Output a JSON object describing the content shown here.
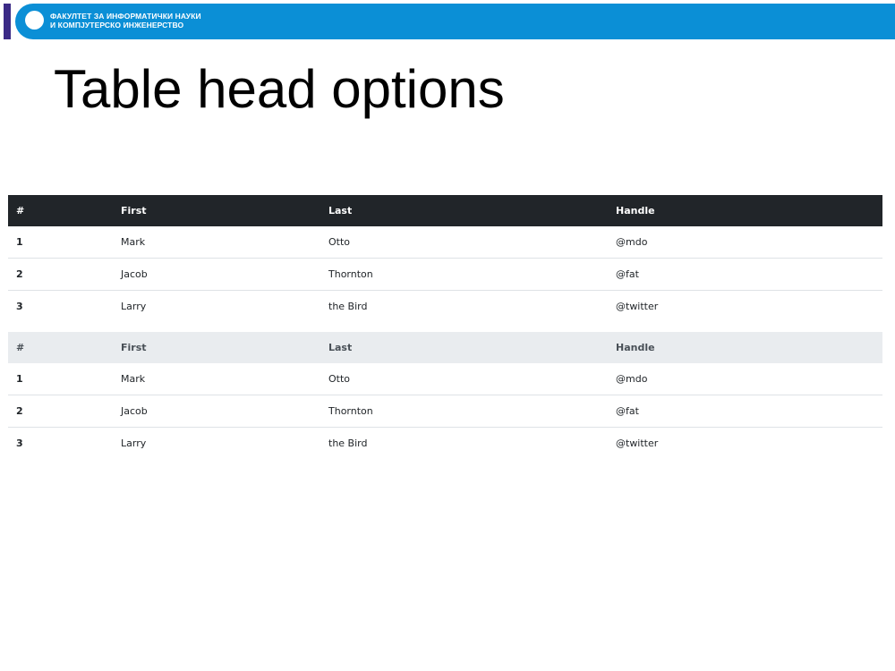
{
  "banner": {
    "line1": "ФАКУЛТЕТ ЗА ИНФОРМАТИЧКИ НАУКИ",
    "line2": "И КОМПЈУТЕРСКО ИНЖЕНЕРСТВО"
  },
  "title": "Table head options",
  "colors": {
    "banner": "#0b8fd6",
    "stripe": "#3b2a86",
    "dark_head": "#212529",
    "light_head": "#e9ecef"
  },
  "tables": [
    {
      "style": "dark",
      "headers": [
        "#",
        "First",
        "Last",
        "Handle"
      ],
      "rows": [
        [
          "1",
          "Mark",
          "Otto",
          "@mdo"
        ],
        [
          "2",
          "Jacob",
          "Thornton",
          "@fat"
        ],
        [
          "3",
          "Larry",
          "the Bird",
          "@twitter"
        ]
      ]
    },
    {
      "style": "light",
      "headers": [
        "#",
        "First",
        "Last",
        "Handle"
      ],
      "rows": [
        [
          "1",
          "Mark",
          "Otto",
          "@mdo"
        ],
        [
          "2",
          "Jacob",
          "Thornton",
          "@fat"
        ],
        [
          "3",
          "Larry",
          "the Bird",
          "@twitter"
        ]
      ]
    }
  ]
}
